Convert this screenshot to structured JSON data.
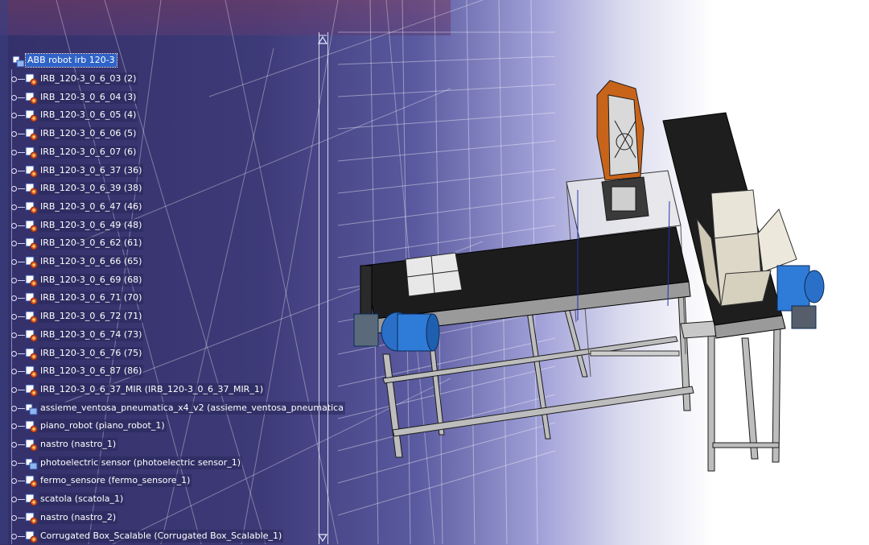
{
  "tree": {
    "root": {
      "label": "ABB robot irb 120-3",
      "icon": "product-assembly-icon"
    },
    "items": [
      {
        "label": "IRB_120-3_0_6_03 (2)",
        "icon": "part-gear-icon"
      },
      {
        "label": "IRB_120-3_0_6_04 (3)",
        "icon": "part-gear-icon"
      },
      {
        "label": "IRB_120-3_0_6_05 (4)",
        "icon": "part-gear-icon"
      },
      {
        "label": "IRB_120-3_0_6_06 (5)",
        "icon": "part-gear-icon"
      },
      {
        "label": "IRB_120-3_0_6_07 (6)",
        "icon": "part-gear-icon"
      },
      {
        "label": "IRB_120-3_0_6_37 (36)",
        "icon": "part-gear-icon"
      },
      {
        "label": "IRB_120-3_0_6_39 (38)",
        "icon": "part-gear-icon"
      },
      {
        "label": "IRB_120-3_0_6_47 (46)",
        "icon": "part-gear-icon"
      },
      {
        "label": "IRB_120-3_0_6_49 (48)",
        "icon": "part-gear-icon"
      },
      {
        "label": "IRB_120-3_0_6_62 (61)",
        "icon": "part-gear-icon"
      },
      {
        "label": "IRB_120-3_0_6_66 (65)",
        "icon": "part-gear-icon"
      },
      {
        "label": "IRB_120-3_0_6_69 (68)",
        "icon": "part-gear-icon"
      },
      {
        "label": "IRB_120-3_0_6_71 (70)",
        "icon": "part-gear-icon"
      },
      {
        "label": "IRB_120-3_0_6_72 (71)",
        "icon": "part-gear-icon"
      },
      {
        "label": "IRB_120-3_0_6_74 (73)",
        "icon": "part-gear-icon"
      },
      {
        "label": "IRB_120-3_0_6_76 (75)",
        "icon": "part-gear-icon"
      },
      {
        "label": "IRB_120-3_0_6_87 (86)",
        "icon": "part-gear-icon"
      },
      {
        "label": "IRB_120-3_0_6_37_MIR (IRB_120-3_0_6_37_MIR_1)",
        "icon": "part-gear-icon"
      },
      {
        "label": "assieme_ventosa_pneumatica_x4_v2 (assieme_ventosa_pneumatica",
        "icon": "sub-assembly-icon"
      },
      {
        "label": "piano_robot (piano_robot_1)",
        "icon": "part-gear-icon"
      },
      {
        "label": "nastro (nastro_1)",
        "icon": "part-gear-icon"
      },
      {
        "label": "photoelectric sensor (photoelectric sensor_1)",
        "icon": "sub-assembly-icon"
      },
      {
        "label": "fermo_sensore (fermo_sensore_1)",
        "icon": "part-gear-icon"
      },
      {
        "label": "scatola (scatola_1)",
        "icon": "part-gear-icon"
      },
      {
        "label": "nastro (nastro_2)",
        "icon": "part-gear-icon"
      },
      {
        "label": "Corrugated Box_Scalable (Corrugated Box_Scalable_1)",
        "icon": "part-gear-icon"
      }
    ]
  },
  "scrollbar": {
    "up_icon": "scroll-up-arrow-icon",
    "down_icon": "scroll-down-arrow-icon"
  },
  "viewport": {
    "model_icon": "robot-conveyor-assembly-3d",
    "colors": {
      "conveyor_belt": "#1c1c1c",
      "motor": "#2a70c8",
      "robot_orange": "#c8641a",
      "frame": "#c0c0c0",
      "box": "#e8e4d8"
    }
  }
}
